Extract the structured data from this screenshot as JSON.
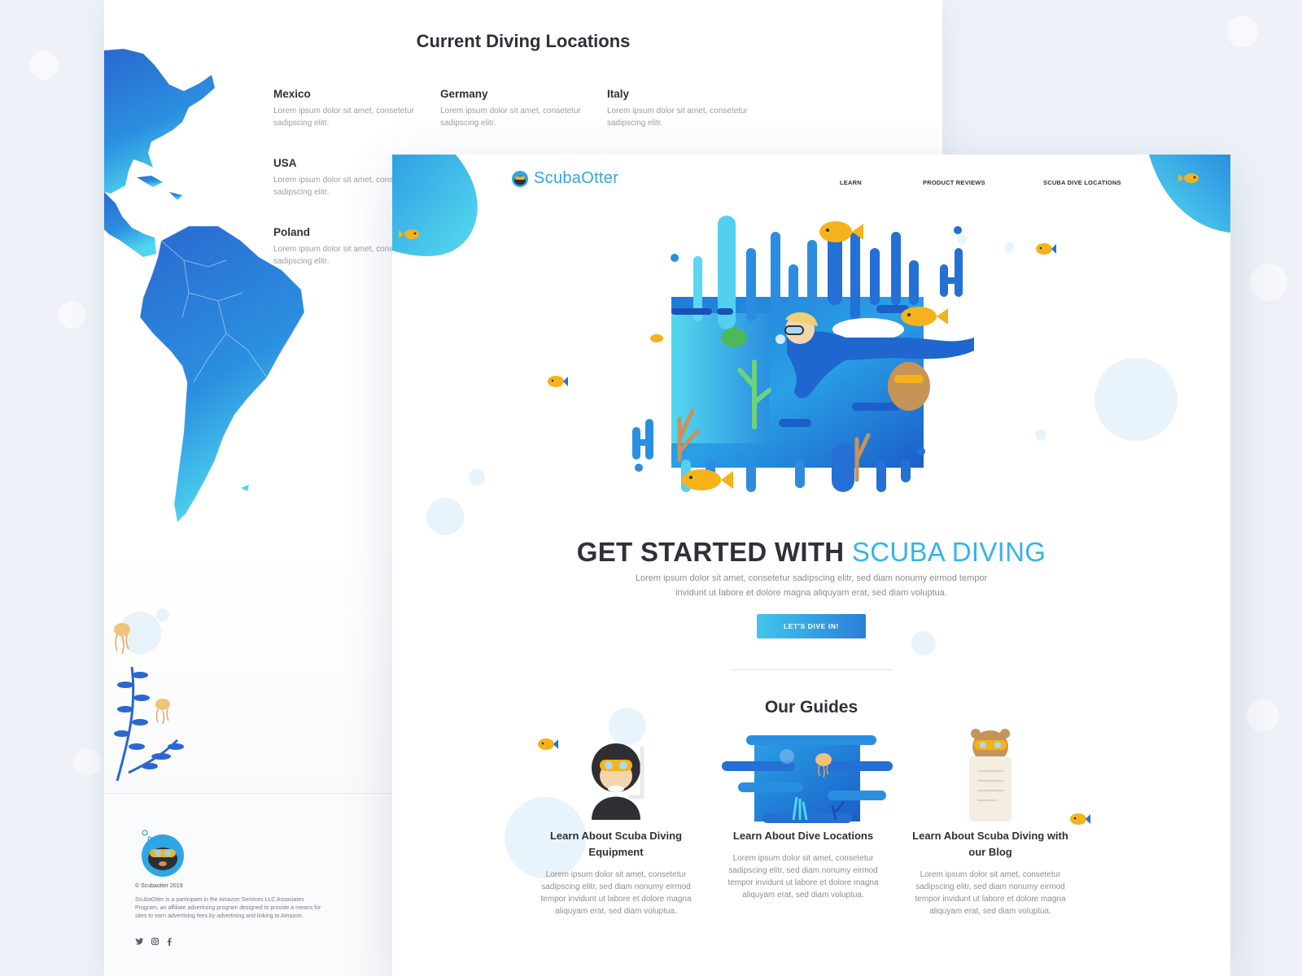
{
  "back": {
    "title": "Current Diving Locations",
    "locations": [
      {
        "name": "Mexico",
        "desc": "Lorem ipsum dolor sit amet, consetetur sadipscing elitr."
      },
      {
        "name": "Germany",
        "desc": "Lorem ipsum dolor sit amet, consetetur sadipscing elitr."
      },
      {
        "name": "Italy",
        "desc": "Lorem ipsum dolor sit amet, consetetur sadipscing elitr."
      },
      {
        "name": "USA",
        "desc": "Lorem ipsum dolor sit amet, consetetur sadipscing elitr."
      },
      {
        "name": "Poland",
        "desc": "Lorem ipsum dolor sit amet, consetetur sadipscing elitr."
      }
    ],
    "footer": {
      "copyright": "© Scubaotter 2019",
      "note": "ScubaOtter is a participant in the Amazon Services LLC Associates Program, an affiliate advertising program designed to provide a means for sites to earn advertising fees by advertising and linking to Amazon.",
      "social": [
        "twitter-icon",
        "instagram-icon",
        "facebook-icon"
      ]
    }
  },
  "front": {
    "brand": "ScubaOtter",
    "nav": [
      "LEARN",
      "PRODUCT REVIEWS",
      "SCUBA DIVE LOCATIONS"
    ],
    "hero": {
      "title_part1": "GET STARTED WITH",
      "title_part2": "SCUBA DIVING",
      "text": "Lorem ipsum dolor sit amet, consetetur sadipscing elitr, sed diam nonumy eirmod tempor invidunt ut labore et dolore magna aliquyam erat, sed diam voluptua.",
      "cta": "LET'S DIVE IN!"
    },
    "guides": {
      "title": "Our Guides",
      "items": [
        {
          "title": "Learn About Scuba Diving Equipment",
          "text": "Lorem ipsum dolor sit amet, consetetur sadipscing elitr, sed diam nonumy eirmod tempor invidunt ut labore et dolore magna aliquyam erat, sed diam voluptua."
        },
        {
          "title": "Learn About Dive Locations",
          "text": "Lorem ipsum dolor sit amet, consetetur sadipscing elitr, sed diam nonumy eirmod tempor invidunt ut labore et dolore magna aliquyam erat, sed diam voluptua."
        },
        {
          "title": "Learn About Scuba Diving with our Blog",
          "text": "Lorem ipsum dolor sit amet, consetetur sadipscing elitr, sed diam nonumy eirmod tempor invidunt ut labore et dolore magna aliquyam erat, sed diam voluptua."
        }
      ]
    }
  },
  "colors": {
    "accent": "#36b3e8",
    "deep_blue": "#2a6fd6",
    "fish_yellow": "#f6b21a",
    "text_dark": "#2f3138"
  }
}
